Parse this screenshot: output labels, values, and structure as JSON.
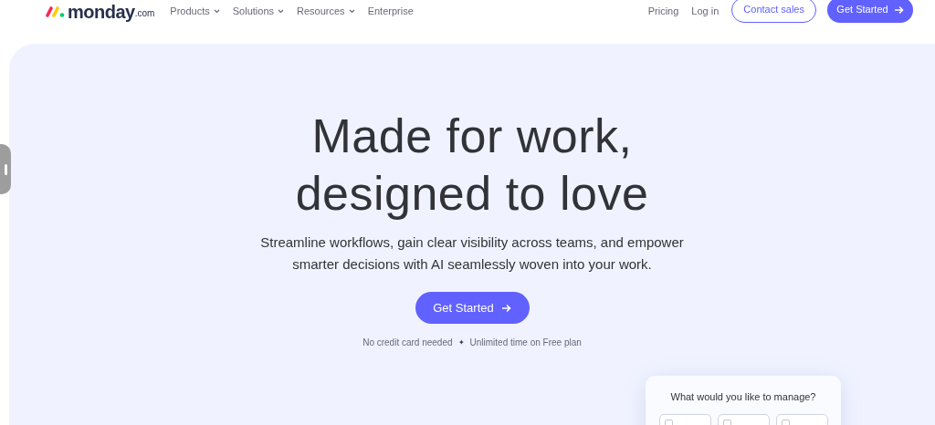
{
  "nav": {
    "logo_text": "monday",
    "logo_suffix": ".com",
    "menu": [
      {
        "label": "Products",
        "dropdown": true
      },
      {
        "label": "Solutions",
        "dropdown": true
      },
      {
        "label": "Resources",
        "dropdown": true
      },
      {
        "label": "Enterprise",
        "dropdown": false
      }
    ],
    "links": [
      "Pricing",
      "Log in"
    ],
    "contact": "Contact sales",
    "cta": "Get Started"
  },
  "hero": {
    "title_lines": [
      "Made for work,",
      "designed to love"
    ],
    "subtitle": "Streamline workflows, gain clear visibility across teams, and empower smarter decisions with AI seamlessly woven into your work.",
    "cta": "Get Started",
    "notes": [
      "No credit card needed",
      "Unlimited time on Free plan"
    ],
    "separator": "✦"
  },
  "card": {
    "question": "What would you like to manage?"
  }
}
